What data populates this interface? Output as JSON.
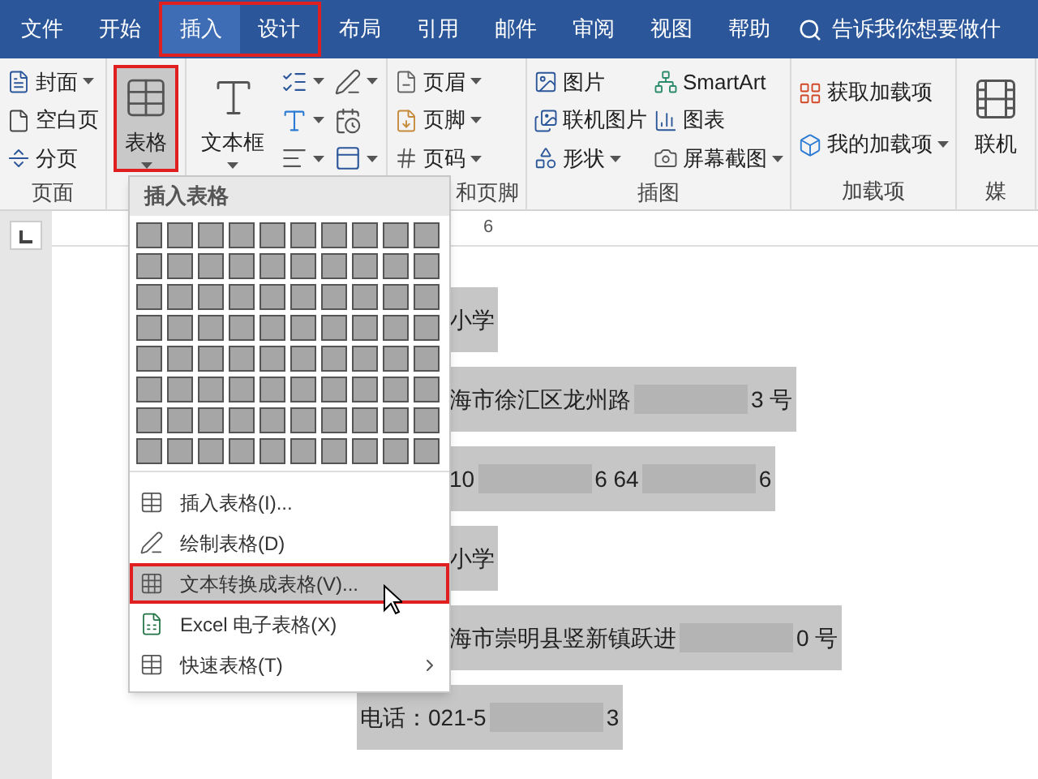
{
  "tabs": [
    {
      "label": "文件",
      "selected": false,
      "highlighted": false
    },
    {
      "label": "开始",
      "selected": false,
      "highlighted": false
    },
    {
      "label": "插入",
      "selected": true,
      "highlighted": true
    },
    {
      "label": "设计",
      "selected": false,
      "highlighted": true
    },
    {
      "label": "布局",
      "selected": false,
      "highlighted": false
    },
    {
      "label": "引用",
      "selected": false,
      "highlighted": false
    },
    {
      "label": "邮件",
      "selected": false,
      "highlighted": false
    },
    {
      "label": "审阅",
      "selected": false,
      "highlighted": false
    },
    {
      "label": "视图",
      "selected": false,
      "highlighted": false
    },
    {
      "label": "帮助",
      "selected": false,
      "highlighted": false
    }
  ],
  "tell_me": {
    "placeholder": "告诉我你想要做什"
  },
  "ribbon": [
    {
      "label": "页面",
      "columns": [
        [
          {
            "kind": "small",
            "label": "封面",
            "dropdown": true
          },
          {
            "kind": "small",
            "label": "空白页",
            "dropdown": false
          },
          {
            "kind": "small",
            "label": "分页",
            "dropdown": false
          }
        ]
      ]
    },
    {
      "columns": [
        [
          {
            "kind": "large",
            "label": "表格",
            "dropdown": true,
            "selected": true,
            "highlighted": true
          }
        ]
      ]
    },
    {
      "columns": [
        [
          {
            "kind": "large",
            "label": "文本框",
            "dropdown": true,
            "selected": false,
            "highlighted": false
          }
        ],
        [
          {
            "kind": "icon",
            "dropdown": true
          },
          {
            "kind": "icon",
            "dropdown": true
          },
          {
            "kind": "icon",
            "dropdown": true
          }
        ],
        [
          {
            "kind": "icon",
            "dropdown": true
          },
          {
            "kind": "icon",
            "dropdown": false
          },
          {
            "kind": "icon",
            "dropdown": true
          }
        ]
      ]
    },
    {
      "label": "和页脚",
      "columns": [
        [
          {
            "kind": "small",
            "label": "页眉",
            "dropdown": true
          },
          {
            "kind": "small",
            "label": "页脚",
            "dropdown": true
          },
          {
            "kind": "small",
            "label": "页码",
            "dropdown": true
          }
        ]
      ]
    },
    {
      "label": "插图",
      "columns": [
        [
          {
            "kind": "small",
            "label": "图片",
            "dropdown": false
          },
          {
            "kind": "small",
            "label": "联机图片",
            "dropdown": false
          },
          {
            "kind": "small",
            "label": "形状",
            "dropdown": true
          }
        ],
        [
          {
            "kind": "small",
            "label": "SmartArt",
            "dropdown": false
          },
          {
            "kind": "small",
            "label": "图表",
            "dropdown": false
          },
          {
            "kind": "small",
            "label": "屏幕截图",
            "dropdown": true
          }
        ]
      ]
    },
    {
      "label": "加载项",
      "columns": [
        [
          {
            "kind": "small",
            "label": "获取加载项",
            "dropdown": false
          },
          {
            "kind": "small",
            "label": "我的加载项",
            "dropdown": true
          }
        ]
      ]
    },
    {
      "label": "媒",
      "columns": [
        [
          {
            "kind": "large",
            "label": "联机",
            "dropdown": false,
            "selected": false,
            "highlighted": false
          }
        ]
      ]
    }
  ],
  "ruler": {
    "label": "6"
  },
  "menu": {
    "title": "插入表格",
    "grid": [
      [
        {
          "selected": true
        },
        {
          "selected": true
        },
        {
          "selected": true
        },
        {
          "selected": true
        },
        {
          "selected": true
        },
        {
          "selected": true
        },
        {
          "selected": true
        },
        {
          "selected": true
        },
        {
          "selected": true
        },
        {
          "selected": true
        }
      ],
      [
        {
          "selected": true
        },
        {
          "selected": true
        },
        {
          "selected": true
        },
        {
          "selected": true
        },
        {
          "selected": true
        },
        {
          "selected": true
        },
        {
          "selected": true
        },
        {
          "selected": true
        },
        {
          "selected": true
        },
        {
          "selected": true
        }
      ],
      [
        {
          "selected": true
        },
        {
          "selected": true
        },
        {
          "selected": true
        },
        {
          "selected": true
        },
        {
          "selected": true
        },
        {
          "selected": true
        },
        {
          "selected": true
        },
        {
          "selected": true
        },
        {
          "selected": true
        },
        {
          "selected": true
        }
      ],
      [
        {
          "selected": true
        },
        {
          "selected": true
        },
        {
          "selected": true
        },
        {
          "selected": true
        },
        {
          "selected": true
        },
        {
          "selected": true
        },
        {
          "selected": true
        },
        {
          "selected": true
        },
        {
          "selected": true
        },
        {
          "selected": true
        }
      ],
      [
        {
          "selected": true
        },
        {
          "selected": true
        },
        {
          "selected": true
        },
        {
          "selected": true
        },
        {
          "selected": true
        },
        {
          "selected": true
        },
        {
          "selected": true
        },
        {
          "selected": true
        },
        {
          "selected": true
        },
        {
          "selected": true
        }
      ],
      [
        {
          "selected": true
        },
        {
          "selected": true
        },
        {
          "selected": true
        },
        {
          "selected": true
        },
        {
          "selected": true
        },
        {
          "selected": true
        },
        {
          "selected": true
        },
        {
          "selected": true
        },
        {
          "selected": true
        },
        {
          "selected": true
        }
      ],
      [
        {
          "selected": true
        },
        {
          "selected": true
        },
        {
          "selected": true
        },
        {
          "selected": true
        },
        {
          "selected": true
        },
        {
          "selected": true
        },
        {
          "selected": true
        },
        {
          "selected": true
        },
        {
          "selected": true
        },
        {
          "selected": true
        }
      ],
      [
        {
          "selected": true
        },
        {
          "selected": true
        },
        {
          "selected": true
        },
        {
          "selected": true
        },
        {
          "selected": true
        },
        {
          "selected": true
        },
        {
          "selected": true
        },
        {
          "selected": true
        },
        {
          "selected": true
        },
        {
          "selected": true
        }
      ]
    ],
    "items": [
      {
        "label": "插入表格(I)...",
        "selected": false,
        "highlighted": false,
        "submenu": false
      },
      {
        "label": "绘制表格(D)",
        "selected": false,
        "highlighted": false,
        "submenu": false
      },
      {
        "label": "文本转换成表格(V)...",
        "selected": true,
        "highlighted": true,
        "submenu": false
      },
      {
        "label": "Excel 电子表格(X)",
        "selected": false,
        "highlighted": false,
        "submenu": false
      },
      {
        "label": "快速表格(T)",
        "selected": false,
        "highlighted": false,
        "submenu": true
      }
    ]
  },
  "document": [
    {
      "indent": false,
      "parts": [
        {
          "kind": "text",
          "text": "小学"
        }
      ]
    },
    {
      "indent": false,
      "parts": [
        {
          "kind": "text",
          "text": "海市徐汇区龙州路"
        },
        {
          "kind": "blur"
        },
        {
          "kind": "text",
          "text": "3 号"
        }
      ]
    },
    {
      "indent": false,
      "parts": [
        {
          "kind": "text",
          "text": "10"
        },
        {
          "kind": "blur"
        },
        {
          "kind": "text",
          "text": "6 64"
        },
        {
          "kind": "blur"
        },
        {
          "kind": "text",
          "text": "6"
        }
      ]
    },
    {
      "indent": false,
      "parts": [
        {
          "kind": "text",
          "text": "小学"
        }
      ]
    },
    {
      "indent": false,
      "parts": [
        {
          "kind": "text",
          "text": "海市崇明县竖新镇跃进"
        },
        {
          "kind": "blur"
        },
        {
          "kind": "text",
          "text": "0 号"
        }
      ]
    },
    {
      "indent": true,
      "parts": [
        {
          "kind": "text",
          "text": "电话：021-5"
        },
        {
          "kind": "blur"
        },
        {
          "kind": "text",
          "text": "3"
        }
      ]
    }
  ]
}
